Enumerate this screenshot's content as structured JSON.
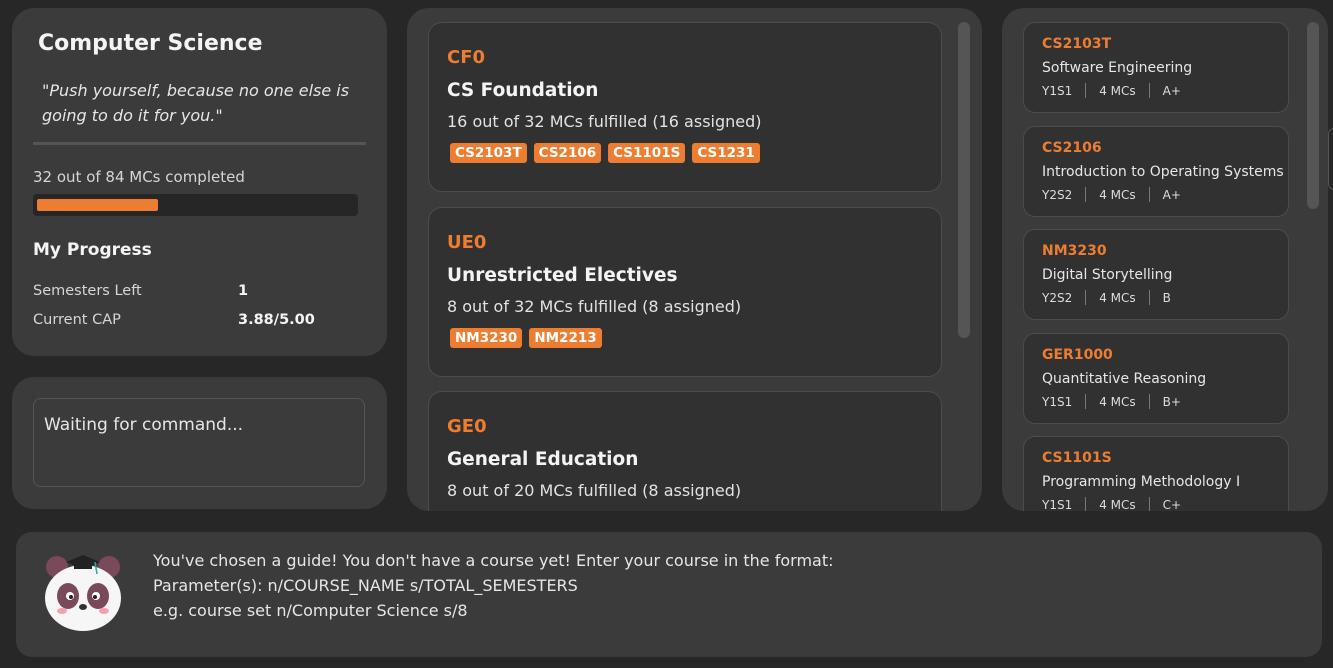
{
  "summary": {
    "course_title": "Computer Science",
    "quote": "\"Push yourself, because no one else is going to do it for you.\"",
    "mcs_completed_text": "32 out of 84 MCs completed",
    "progress_fraction": 0.381,
    "progress_title": "My Progress",
    "semesters_left_label": "Semesters Left",
    "semesters_left_value": "1",
    "cap_label": "Current CAP",
    "cap_value": "3.88/5.00"
  },
  "command": {
    "placeholder": "Waiting for command..."
  },
  "requirements": [
    {
      "code": "CF0",
      "title": "CS Foundation",
      "desc": "16 out of 32 MCs fulfilled (16 assigned)",
      "tags": [
        "CS2103T",
        "CS2106",
        "CS1101S",
        "CS1231"
      ]
    },
    {
      "code": "UE0",
      "title": "Unrestricted Electives",
      "desc": "8 out of 32 MCs fulfilled (8 assigned)",
      "tags": [
        "NM3230",
        "NM2213"
      ]
    },
    {
      "code": "GE0",
      "title": "General Education",
      "desc": "8 out of 20 MCs fulfilled (8 assigned)",
      "tags": []
    }
  ],
  "modules": [
    {
      "code": "CS2103T",
      "name": "Software Engineering",
      "semester": "Y1S1",
      "mcs": "4 MCs",
      "grade": "A+"
    },
    {
      "code": "CS2106",
      "name": "Introduction to Operating Systems",
      "semester": "Y2S2",
      "mcs": "4 MCs",
      "grade": "A+"
    },
    {
      "code": "NM3230",
      "name": "Digital Storytelling",
      "semester": "Y2S2",
      "mcs": "4 MCs",
      "grade": "B"
    },
    {
      "code": "GER1000",
      "name": "Quantitative Reasoning",
      "semester": "Y1S1",
      "mcs": "4 MCs",
      "grade": "B+"
    },
    {
      "code": "CS1101S",
      "name": "Programming Methodology I",
      "semester": "Y1S1",
      "mcs": "4 MCs",
      "grade": "C+"
    }
  ],
  "result": {
    "line1": "You've chosen a guide! You don't have a course yet! Enter your course in the format:",
    "line2": "Parameter(s): n/COURSE_NAME s/TOTAL_SEMESTERS",
    "line3": "e.g. course set n/Computer Science s/8"
  },
  "colors": {
    "accent": "#ed7d31",
    "background": "#272727",
    "panel": "#3b3b3b",
    "card": "#313131"
  },
  "icons": {
    "mascot": "panda-graduate-icon"
  }
}
